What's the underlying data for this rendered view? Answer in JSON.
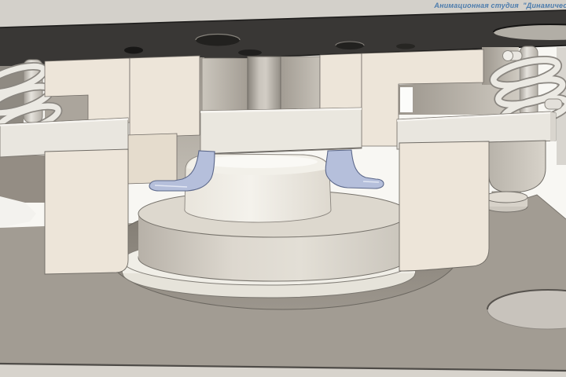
{
  "watermark": {
    "text": "Анимационная студия  \"Динамическо",
    "color": "#4c7cad"
  },
  "scene": {
    "description": "3D CAD animation still of a deep-drawing die assembly (press tooling) with springs, punch, blank holder, drawn cup and die base",
    "parts": [
      {
        "id": "top-plate",
        "label": "upper die plate"
      },
      {
        "id": "left-spring",
        "label": "left coil spring"
      },
      {
        "id": "right-spring",
        "label": "right coil spring"
      },
      {
        "id": "punch-shank",
        "label": "punch shank"
      },
      {
        "id": "holder-blocks",
        "label": "punch holder blocks"
      },
      {
        "id": "blank-holder-plate",
        "label": "blank holder plate"
      },
      {
        "id": "blank-flange",
        "label": "sheet-metal blank flange"
      },
      {
        "id": "drawn-cup",
        "label": "drawn cup part"
      },
      {
        "id": "die-cylinder",
        "label": "draw die cylinder"
      },
      {
        "id": "base-plate",
        "label": "die shoe base plate"
      },
      {
        "id": "base-hole",
        "label": "bolt hole in base plate"
      }
    ]
  },
  "colors": {
    "background": "#f8f7f3",
    "top_band": "#d3d0ca",
    "plate_dark": "#393735",
    "hole_dark": "#22211f",
    "hole_light": "#b2aea6",
    "beige": "#ede5d9",
    "beige_shade": "#e5dccd",
    "ivory_band": "#eae7df",
    "bar": "#e9e6df",
    "gray_mid": "#aba59c",
    "gray_dark": "#948d84",
    "spring_light": "#ebe9e3",
    "cup_white": "#f2f0e9",
    "flange_blue": "#b5bfdb",
    "flange_edge": "#5c688a",
    "die_light": "#ddd8ce",
    "ring_white": "#f0eee7",
    "pocket": "#867f77",
    "base_taupe": "#a29c93",
    "base_front": "#d7d3cc",
    "hole_fill": "#c8c3bc"
  }
}
